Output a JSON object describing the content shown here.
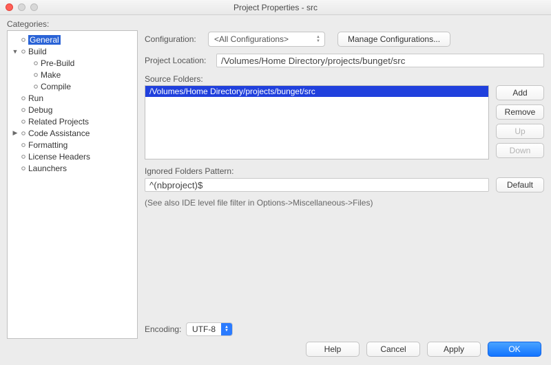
{
  "window": {
    "title": "Project Properties - src"
  },
  "sidebar": {
    "label": "Categories:",
    "items": [
      {
        "label": "General",
        "depth": 1,
        "expand": "",
        "selected": true
      },
      {
        "label": "Build",
        "depth": 1,
        "expand": "open"
      },
      {
        "label": "Pre-Build",
        "depth": 2,
        "expand": ""
      },
      {
        "label": "Make",
        "depth": 2,
        "expand": ""
      },
      {
        "label": "Compile",
        "depth": 2,
        "expand": ""
      },
      {
        "label": "Run",
        "depth": 1,
        "expand": ""
      },
      {
        "label": "Debug",
        "depth": 1,
        "expand": ""
      },
      {
        "label": "Related Projects",
        "depth": 1,
        "expand": ""
      },
      {
        "label": "Code Assistance",
        "depth": 1,
        "expand": "closed"
      },
      {
        "label": "Formatting",
        "depth": 1,
        "expand": ""
      },
      {
        "label": "License Headers",
        "depth": 1,
        "expand": ""
      },
      {
        "label": "Launchers",
        "depth": 1,
        "expand": ""
      }
    ]
  },
  "config": {
    "label": "Configuration:",
    "value": "<All Configurations>",
    "manage": "Manage Configurations..."
  },
  "location": {
    "label": "Project Location:",
    "value": "/Volumes/Home Directory/projects/bunget/src"
  },
  "source_folders": {
    "label": "Source Folders:",
    "items": [
      "/Volumes/Home Directory/projects/bunget/src"
    ],
    "add": "Add",
    "remove": "Remove",
    "up": "Up",
    "down": "Down"
  },
  "ignored": {
    "label": "Ignored Folders Pattern:",
    "value": "^(nbproject)$",
    "default": "Default",
    "hint": "(See also IDE level file filter in Options->Miscellaneous->Files)"
  },
  "encoding": {
    "label": "Encoding:",
    "value": "UTF-8"
  },
  "footer": {
    "help": "Help",
    "cancel": "Cancel",
    "apply": "Apply",
    "ok": "OK"
  }
}
